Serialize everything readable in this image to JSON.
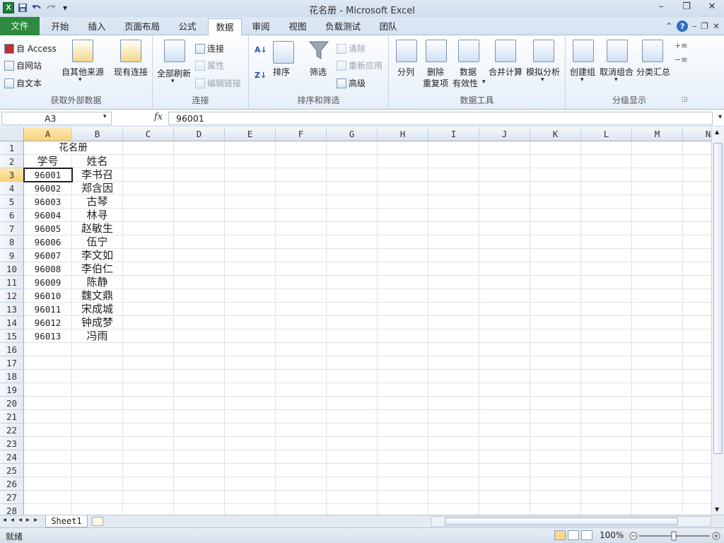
{
  "window": {
    "title": "花名册 - Microsoft Excel",
    "controls": [
      "–",
      "❐",
      "✕"
    ]
  },
  "qat": {
    "logo": "X"
  },
  "tabs": [
    {
      "label": "文件",
      "kind": "file"
    },
    {
      "label": "开始"
    },
    {
      "label": "插入"
    },
    {
      "label": "页面布局"
    },
    {
      "label": "公式"
    },
    {
      "label": "数据",
      "active": true
    },
    {
      "label": "审阅"
    },
    {
      "label": "视图"
    },
    {
      "label": "负载测试"
    },
    {
      "label": "团队"
    }
  ],
  "ribbon": {
    "external": {
      "label": "获取外部数据",
      "access": "自 Access",
      "web": "自网站",
      "text": "自文本",
      "other": "自其他来源",
      "existing": "现有连接"
    },
    "connections": {
      "label": "连接",
      "refresh_all": "全部刷新",
      "connections": "连接",
      "properties": "属性",
      "edit_links": "编辑链接"
    },
    "sort_filter": {
      "label": "排序和筛选",
      "sort": "排序",
      "filter": "筛选",
      "clear": "清除",
      "reapply": "重新应用",
      "advanced": "高级"
    },
    "data_tools": {
      "label": "数据工具",
      "text_to_columns": "分列",
      "remove_dup_1": "删除",
      "remove_dup_2": "重复项",
      "validation_1": "数据",
      "validation_2": "有效性",
      "consolidate": "合并计算",
      "whatif": "模拟分析"
    },
    "outline": {
      "label": "分级显示",
      "group": "创建组",
      "ungroup": "取消组合",
      "subtotal": "分类汇总"
    }
  },
  "formula_bar": {
    "name_box": "A3",
    "fx": "fx",
    "value": "96001"
  },
  "sheet": {
    "columns": [
      "A",
      "B",
      "C",
      "D",
      "E",
      "F",
      "G",
      "H",
      "I",
      "J",
      "K",
      "L",
      "M",
      "N"
    ],
    "rows": [
      "1",
      "2",
      "3",
      "4",
      "5",
      "6",
      "7",
      "8",
      "9",
      "10",
      "11",
      "12",
      "13",
      "14",
      "15",
      "16",
      "17",
      "18",
      "19",
      "20",
      "21",
      "22",
      "23",
      "24",
      "25",
      "26",
      "27",
      "28"
    ],
    "title": "花名册",
    "headers": [
      "学号",
      "姓名"
    ],
    "records": [
      [
        "96001",
        "李书召"
      ],
      [
        "96002",
        "郑含因"
      ],
      [
        "96003",
        "古琴"
      ],
      [
        "96004",
        "林寻"
      ],
      [
        "96005",
        "赵敏生"
      ],
      [
        "96006",
        "伍宁"
      ],
      [
        "96007",
        "李文如"
      ],
      [
        "96008",
        "李伯仁"
      ],
      [
        "96009",
        "陈静"
      ],
      [
        "96010",
        "魏文鼎"
      ],
      [
        "96011",
        "宋成城"
      ],
      [
        "96012",
        "钟成梦"
      ],
      [
        "96013",
        "冯雨"
      ]
    ]
  },
  "sheet_tabs": [
    "Sheet1"
  ],
  "status": {
    "ready": "就绪",
    "zoom": "100%"
  }
}
